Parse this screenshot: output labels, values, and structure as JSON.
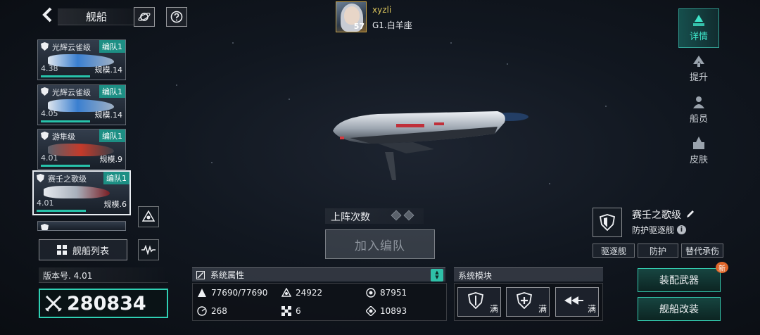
{
  "header": {
    "title": "舰船",
    "user": {
      "name": "xyzli",
      "level": "57",
      "rank": "G1.白羊座"
    }
  },
  "right_nav": [
    {
      "label": "详情",
      "icon": "details-icon",
      "active": true
    },
    {
      "label": "提升",
      "icon": "upgrade-icon",
      "active": false
    },
    {
      "label": "船员",
      "icon": "crew-icon",
      "active": false
    },
    {
      "label": "皮肤",
      "icon": "skin-icon",
      "active": false
    }
  ],
  "ship_cards": [
    {
      "name": "光辉云雀级",
      "fleet": "编队1",
      "score": "4.38",
      "scale": "规模.14",
      "color": "#3a7fd0",
      "selected": false
    },
    {
      "name": "光辉云雀级",
      "fleet": "编队1",
      "score": "4.05",
      "scale": "规模.14",
      "color": "#3a7fd0",
      "selected": false
    },
    {
      "name": "游隼级",
      "fleet": "编队1",
      "score": "4.01",
      "scale": "规模.9",
      "color": "#c43a2a",
      "selected": false
    },
    {
      "name": "赛壬之歌级",
      "fleet": "编队1",
      "score": "4.01",
      "scale": "规模.6",
      "color": "#a8b0bb",
      "selected": true
    }
  ],
  "ship_list_button": "舰船列表",
  "version": "版本号. 4.01",
  "power": "280834",
  "deploy": {
    "label": "上阵次数",
    "join_button": "加入编队"
  },
  "attributes": {
    "title": "系统属性",
    "items": [
      {
        "icon": "durability-icon",
        "value": "77690/77690"
      },
      {
        "icon": "armor-icon",
        "value": "24922"
      },
      {
        "icon": "firepower-icon",
        "value": "87951"
      },
      {
        "icon": "speed-icon",
        "value": "268"
      },
      {
        "icon": "evasion-icon",
        "value": "6"
      },
      {
        "icon": "energy-icon",
        "value": "10893"
      }
    ]
  },
  "modules": {
    "title": "系统模块",
    "items": [
      {
        "icon": "shield-module-icon",
        "status": "满"
      },
      {
        "icon": "repair-module-icon",
        "status": "满"
      },
      {
        "icon": "engine-module-icon",
        "status": "满"
      }
    ]
  },
  "ship_info": {
    "name": "赛壬之歌级",
    "role": "防护驱逐舰",
    "info_mark": "i",
    "tags": [
      "驱逐舰",
      "防护",
      "替代承伤"
    ]
  },
  "actions": {
    "equip": "装配武器",
    "refit": "舰船改装",
    "new_badge": "新"
  },
  "colors": {
    "accent": "#2fd0b3",
    "gold": "#d9c35c",
    "fleet_tag": "#1d8f84"
  }
}
